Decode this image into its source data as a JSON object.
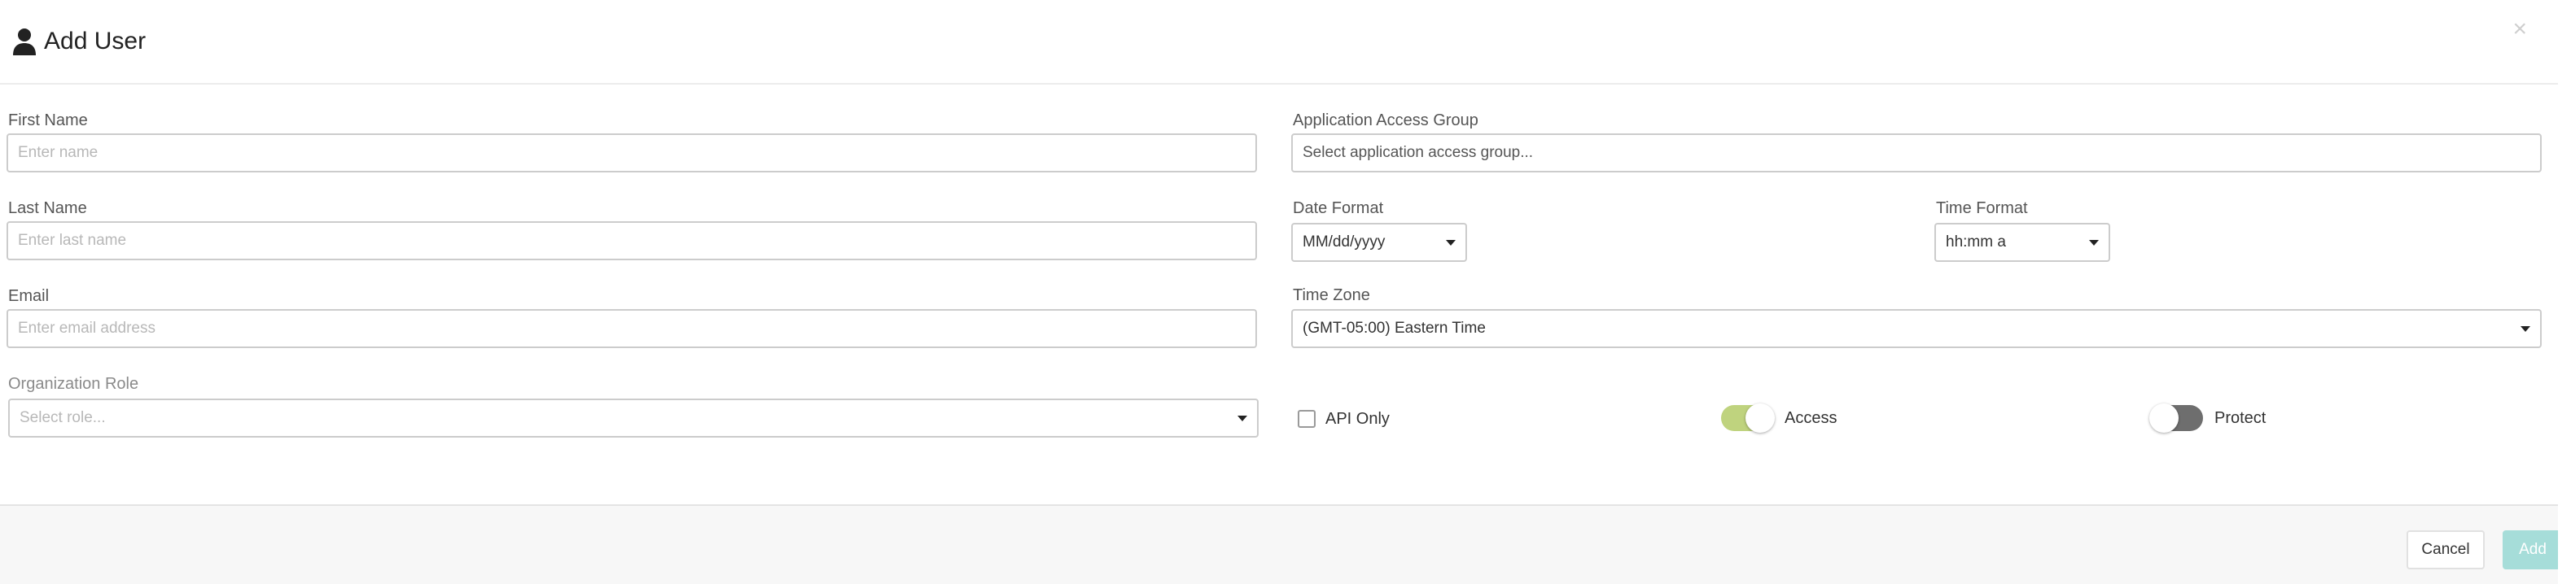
{
  "modal": {
    "title": "Add User",
    "close_glyph": "×",
    "title_icon": "user-icon",
    "close_icon": "close-icon"
  },
  "form": {
    "first_name": {
      "label": "First Name",
      "placeholder": "Enter name",
      "value": ""
    },
    "last_name": {
      "label": "Last Name",
      "placeholder": "Enter last name",
      "value": ""
    },
    "email": {
      "label": "Email",
      "placeholder": "Enter email address",
      "value": ""
    },
    "organization_role": {
      "label": "Organization Role",
      "placeholder": "Select role..."
    },
    "application_access_group": {
      "label": "Application Access Group",
      "placeholder": "Select application access group..."
    },
    "date_format": {
      "label": "Date Format",
      "value": "MM/dd/yyyy"
    },
    "time_format": {
      "label": "Time Format",
      "value": "hh:mm a"
    },
    "time_zone": {
      "label": "Time Zone",
      "value": "(GMT-05:00) Eastern Time"
    },
    "api_only": {
      "label": "API Only",
      "checked": false
    },
    "access": {
      "label": "Access",
      "on": true
    },
    "protect": {
      "label": "Protect",
      "on": false
    }
  },
  "footer": {
    "cancel_label": "Cancel",
    "add_label": "Add"
  },
  "colors": {
    "toggle_on": "#bfd37e",
    "toggle_off": "#6e6e6e",
    "add_button_disabled": "#a6ddd9",
    "border": "#cccccc",
    "footer_bg": "#f7f7f7"
  }
}
